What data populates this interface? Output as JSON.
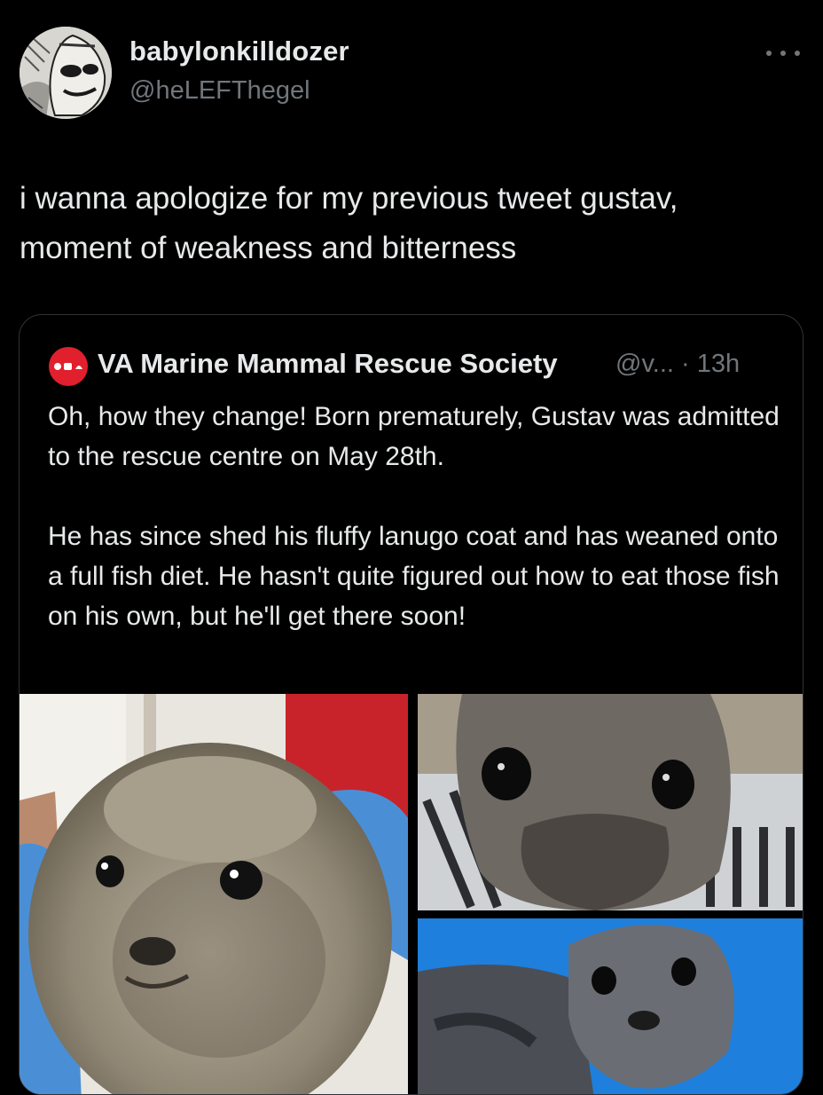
{
  "author": {
    "display_name": "babylonkilldozer",
    "handle": "@heLEFThegel",
    "avatar_icon": "manga-avatar"
  },
  "tweet": {
    "text": "i wanna apologize for my previous tweet gustav,\nmoment of weakness and bitterness"
  },
  "more_icon": "ellipsis-icon",
  "quoted": {
    "display_name": "VA Marine Mammal Rescue Society",
    "meta": "@v... · 13h",
    "avatar_color": "#e0202c",
    "paragraphs": [
      "Oh, how they change! Born prematurely, Gustav was admitted to the rescue centre on May 28th.",
      "He has since shed his fluffy lanugo coat and has weaned onto a full fish diet. He hasn't quite figured out how to eat those fish on his own, but he'll get there soon!"
    ],
    "media": [
      {
        "icon": "seal-pup-photo"
      },
      {
        "icon": "seal-closeup-photo"
      },
      {
        "icon": "seal-on-blue-photo"
      }
    ]
  },
  "colors": {
    "background": "#000000",
    "text_primary": "#e7e9ea",
    "text_secondary": "#71767b",
    "border": "#2f3336"
  }
}
